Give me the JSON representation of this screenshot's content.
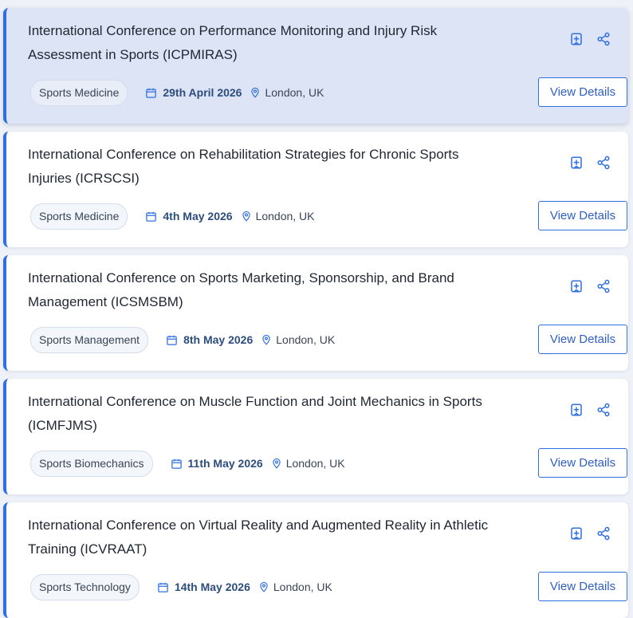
{
  "button_label": "View Details",
  "icons": {
    "bookmark": "bookmark-add-icon",
    "share": "share-icon",
    "calendar": "calendar-icon",
    "location": "location-pin-icon"
  },
  "colors": {
    "accent": "#2f6fe0",
    "date_text": "#2c4d7d",
    "highlight_bg": "#dde4f5"
  },
  "conferences": [
    {
      "title_line1": "International Conference on Performance Monitoring and Injury Risk",
      "title_line2": "Assessment in Sports (ICPMIRAS)",
      "category": "Sports Medicine",
      "date": "29th April 2026",
      "location": "London, UK",
      "highlighted": true
    },
    {
      "title_line1": "International Conference on Rehabilitation Strategies for Chronic Sports",
      "title_line2": "Injuries (ICRSCSI)",
      "category": "Sports Medicine",
      "date": "4th May 2026",
      "location": "London, UK",
      "highlighted": false
    },
    {
      "title_line1": "International Conference on Sports Marketing, Sponsorship, and Brand",
      "title_line2": "Management (ICSMSBM)",
      "category": "Sports Management",
      "date": "8th May 2026",
      "location": "London, UK",
      "highlighted": false
    },
    {
      "title_line1": "International Conference on Muscle Function and Joint Mechanics in Sports",
      "title_line2": "(ICMFJMS)",
      "category": "Sports Biomechanics",
      "date": "11th May 2026",
      "location": "London, UK",
      "highlighted": false
    },
    {
      "title_line1": "International Conference on Virtual Reality and Augmented Reality in Athletic",
      "title_line2": "Training (ICVRAAT)",
      "category": "Sports Technology",
      "date": "14th May 2026",
      "location": "London, UK",
      "highlighted": false
    }
  ]
}
